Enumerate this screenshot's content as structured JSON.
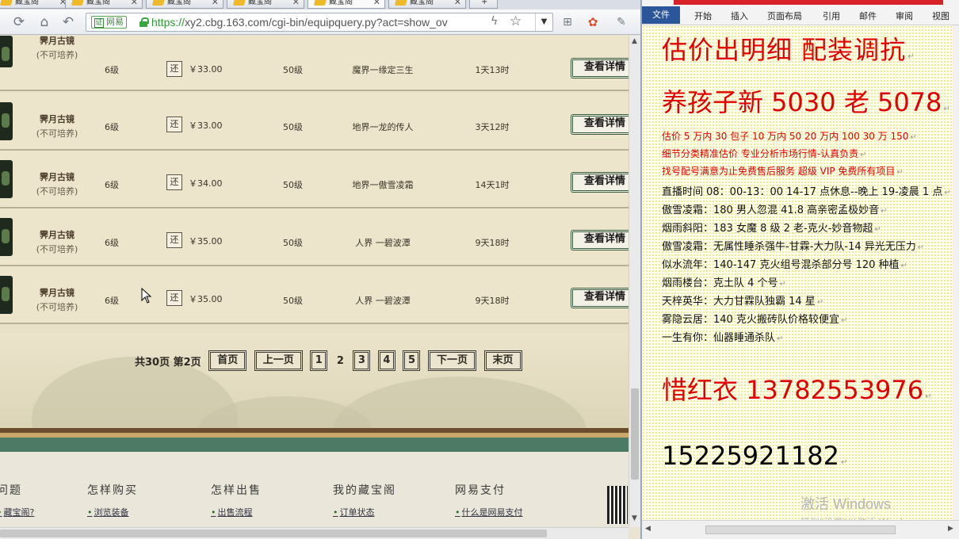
{
  "browser": {
    "tabs": [
      {
        "label": "藏宝阁"
      },
      {
        "label": "藏宝阁"
      },
      {
        "label": "藏宝阁"
      },
      {
        "label": "藏宝阁"
      },
      {
        "label": "藏宝阁"
      },
      {
        "label": "藏宝阁"
      }
    ],
    "new_tab_label": "+",
    "secure_badge": "网易",
    "url_scheme": "https://",
    "url_rest": "xy2.cbg.163.com/cgi-bin/equipquery.py?act=show_ov",
    "icons": {
      "refresh": "refresh-icon",
      "home": "home-icon",
      "back": "back-icon",
      "star": "star-icon"
    }
  },
  "listing": {
    "rows": [
      {
        "name": "霁月古镜",
        "note": "(不可培养)",
        "level": "6级",
        "return_label": "还",
        "price": "￥33.00",
        "req": "50级",
        "server": "魔界一缘定三生",
        "time": "1天13时",
        "detail": "查看详情"
      },
      {
        "name": "霁月古镜",
        "note": "(不可培养)",
        "level": "6级",
        "return_label": "还",
        "price": "￥33.00",
        "req": "50级",
        "server": "地界一龙的传人",
        "time": "3天12时",
        "detail": "查看详情"
      },
      {
        "name": "霁月古镜",
        "note": "(不可培养)",
        "level": "6级",
        "return_label": "还",
        "price": "￥34.00",
        "req": "50级",
        "server": "地界一傲雪凌霜",
        "time": "14天1时",
        "detail": "查看详情"
      },
      {
        "name": "霁月古镜",
        "note": "(不可培养)",
        "level": "6级",
        "return_label": "还",
        "price": "￥35.00",
        "req": "50级",
        "server": "人界 一碧波潭",
        "time": "9天18时",
        "detail": "查看详情"
      },
      {
        "name": "霁月古镜",
        "note": "(不可培养)",
        "level": "6级",
        "return_label": "还",
        "price": "￥35.00",
        "req": "50级",
        "server": "人界 一碧波潭",
        "time": "9天18时",
        "detail": "查看详情"
      }
    ]
  },
  "pagination": {
    "summary": "共30页",
    "current_text": "第2页",
    "first": "首页",
    "prev": "上一页",
    "pages": [
      "1",
      "2",
      "3",
      "4",
      "5"
    ],
    "current_page": "2",
    "next": "下一页",
    "last": "末页"
  },
  "footer": {
    "columns": [
      {
        "heading": "问题",
        "link": "藏宝阁?"
      },
      {
        "heading": "怎样购买",
        "link": "浏览装备"
      },
      {
        "heading": "怎样出售",
        "link": "出售流程"
      },
      {
        "heading": "我的藏宝阁",
        "link": "订单状态"
      },
      {
        "heading": "网易支付",
        "link": "什么是网易支付"
      }
    ]
  },
  "word": {
    "ribbon_tabs": [
      "文件",
      "开始",
      "插入",
      "页面布局",
      "引用",
      "邮件",
      "审阅",
      "视图"
    ],
    "lines": [
      "估价出明细 配装调抗",
      "养孩子新 5030 老 5078",
      "估价 5 万内 30 包子  10 万内 50  20 万内 100  30 万 150",
      "细节分类精准估价  专业分析市场行情-认真负责",
      "找号配号满意为止免费售后服务   超级 VIP 免费所有项目",
      "直播时间 08：00-13：00  14-17 点休息--晚上 19-凌晨 1 点",
      "傲雪凌霜：180 男人忽混 41.8 高亲密孟极妙音",
      "烟雨斜阳：183 女魔 8 级 2 老-克火-妙音物超",
      "傲雪凌霜：无属性睡杀强牛-甘霖-大力队-14 异光无压力",
      "似水流年：140-147 克火组号混杀部分号 120 种植",
      "烟雨楼台：克土队 4 个号",
      "天梓英华：大力甘霖队独霸 14 星",
      "雾隐云居：140 克火搬砖队价格较便宜",
      "一生有你：仙器睡通杀队",
      "惜红衣 13782553976",
      "15225921182"
    ],
    "paragraph_mark": "↵",
    "watermark_title": "激活 Windows",
    "watermark_sub": "转到\"设置\"以激活 Windows。"
  }
}
